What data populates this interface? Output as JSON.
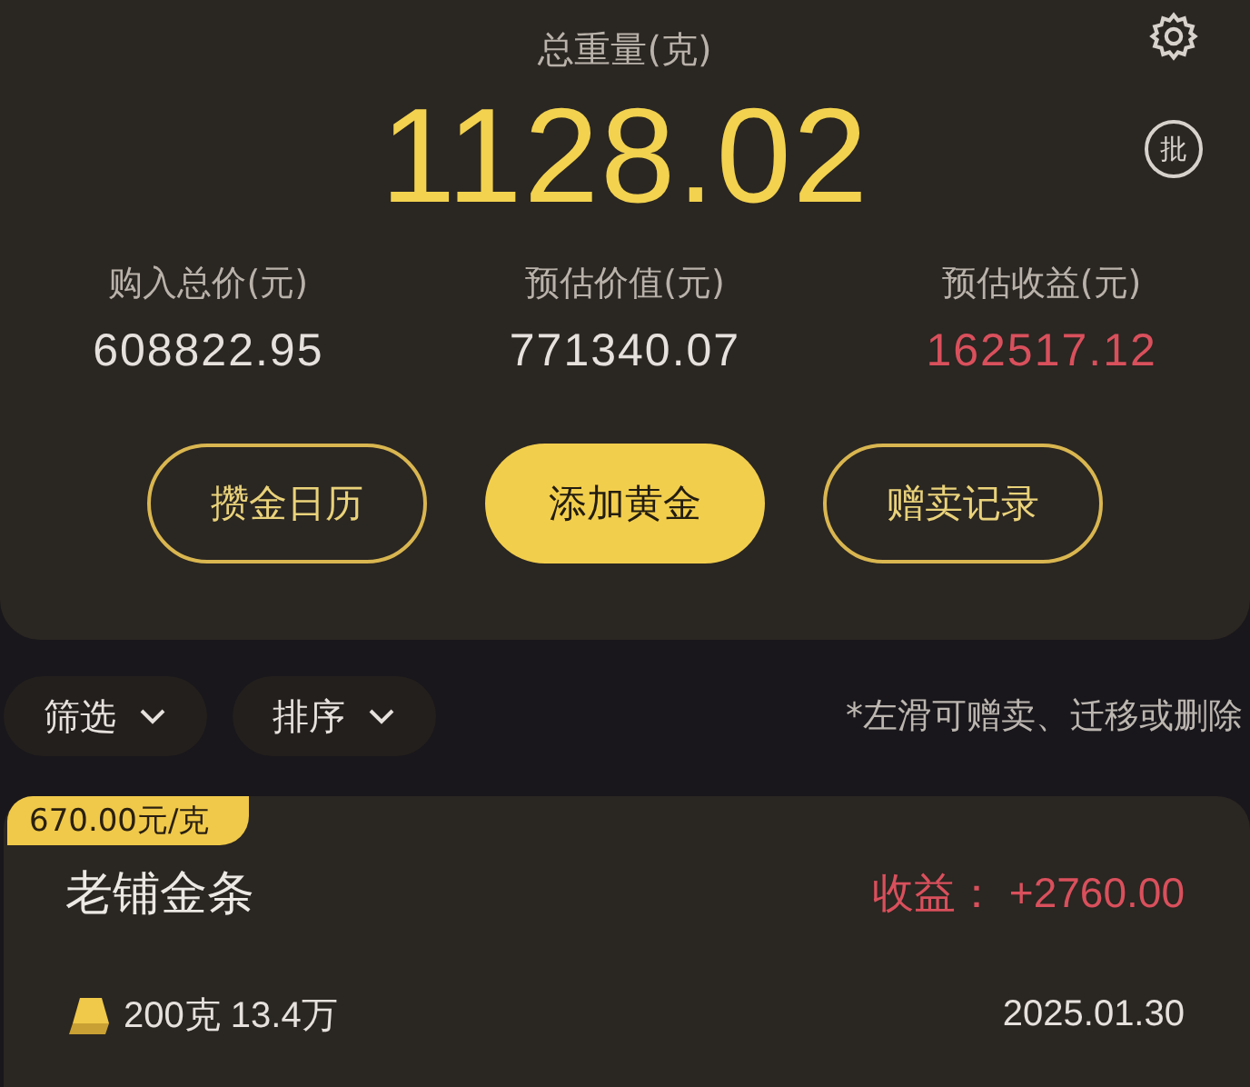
{
  "header": {
    "title": "总重量(克)",
    "total": "1128.02",
    "batch_badge": "批"
  },
  "stats": [
    {
      "label": "购入总价(元)",
      "value": "608822.95",
      "kind": "plain"
    },
    {
      "label": "预估价值(元)",
      "value": "771340.07",
      "kind": "plain"
    },
    {
      "label": "预估收益(元)",
      "value": "162517.12",
      "kind": "profit"
    }
  ],
  "actions": [
    {
      "label": "攒金日历",
      "kind": "outline"
    },
    {
      "label": "添加黄金",
      "kind": "filled"
    },
    {
      "label": "赠卖记录",
      "kind": "outline"
    }
  ],
  "filters": [
    {
      "label": "筛选"
    },
    {
      "label": "排序"
    }
  ],
  "hint": "*左滑可赠卖、迁移或删除",
  "items": [
    {
      "price_tag": "670.00元/克",
      "name": "老铺金条",
      "profit": "收益： +2760.00",
      "weight": "200克 13.4万",
      "date": "2025.01.30"
    }
  ]
}
